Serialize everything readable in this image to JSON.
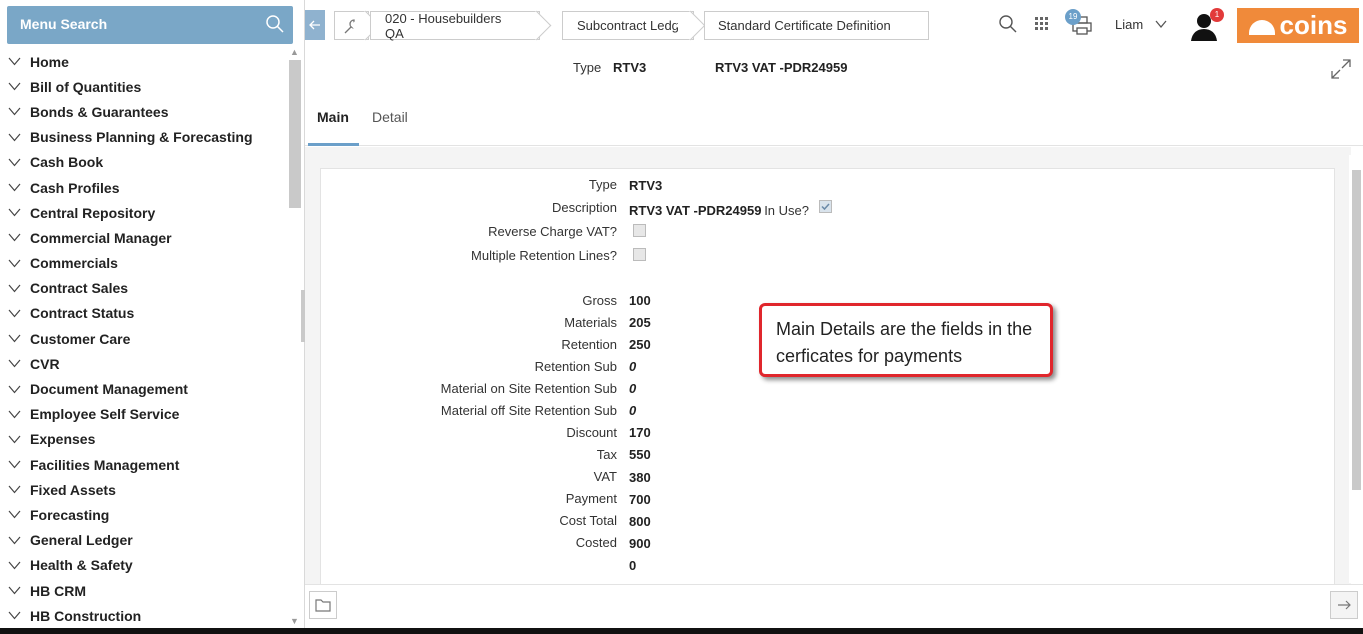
{
  "sidebar": {
    "search_label": "Menu Search",
    "items": [
      "Home",
      "Bill of Quantities",
      "Bonds & Guarantees",
      "Business Planning & Forecasting",
      "Cash Book",
      "Cash Profiles",
      "Central Repository",
      "Commercial Manager",
      "Commercials",
      "Contract Sales",
      "Contract Status",
      "Customer Care",
      "CVR",
      "Document Management",
      "Employee Self Service",
      "Expenses",
      "Facilities Management",
      "Fixed Assets",
      "Forecasting",
      "General Ledger",
      "Health & Safety",
      "HB CRM",
      "HB Construction"
    ]
  },
  "topbar": {
    "breadcrumb_company": "020 - Housebuilders QA",
    "breadcrumb_ledger": "Subcontract Ledger",
    "breadcrumb_definition": "Standard Certificate Definition",
    "print_badge": "19",
    "user_name": "Liam",
    "notification_badge": "1",
    "logo_text": "coins"
  },
  "header": {
    "type_label": "Type",
    "type_value": "RTV3",
    "description": "RTV3 VAT -PDR24959"
  },
  "tabs": {
    "main": "Main",
    "detail": "Detail"
  },
  "form": {
    "type_label": "Type",
    "type_value": "RTV3",
    "description_label": "Description",
    "description_value": "RTV3 VAT -PDR24959",
    "in_use_label": "In Use?",
    "reverse_charge_label": "Reverse Charge VAT?",
    "multiple_retention_label": "Multiple Retention Lines?",
    "gross_label": "Gross",
    "gross_value": "100",
    "materials_label": "Materials",
    "materials_value": "205",
    "retention_label": "Retention",
    "retention_value": "250",
    "retention_sub_label": "Retention Sub",
    "retention_sub_value": "0",
    "mos_label": "Material on Site Retention Sub",
    "mos_value": "0",
    "mofs_label": "Material off Site Retention Sub",
    "mofs_value": "0",
    "discount_label": "Discount",
    "discount_value": "170",
    "tax_label": "Tax",
    "tax_value": "550",
    "vat_label": "VAT",
    "vat_value": "380",
    "payment_label": "Payment",
    "payment_value": "700",
    "cost_total_label": "Cost Total",
    "cost_total_value": "800",
    "costed_label": "Costed",
    "costed_value": "900",
    "blank_value": "0"
  },
  "callout": {
    "text": "Main Details are the fields in the cerficates for payments"
  },
  "colors": {
    "accent": "#7aa7c7",
    "brand": "#f08a3a",
    "callout_border": "#e0262c"
  }
}
